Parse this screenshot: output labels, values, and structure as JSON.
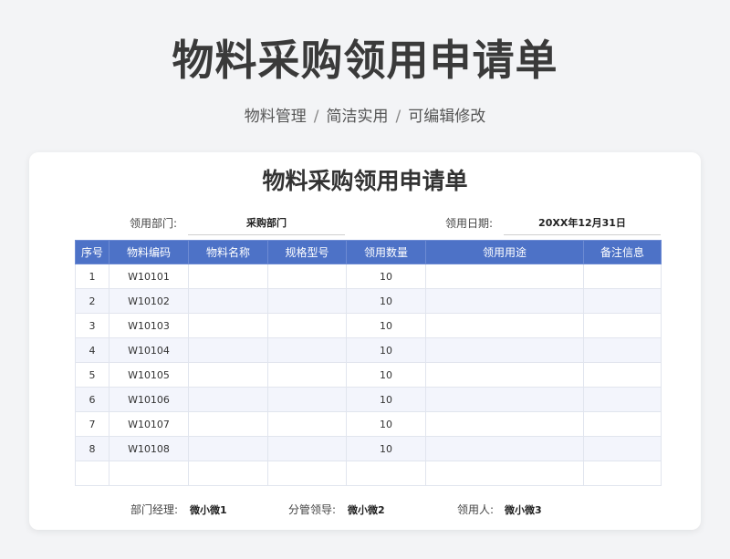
{
  "hero": {
    "title": "物料采购领用申请单",
    "subtitle_parts": [
      "物料管理",
      "简洁实用",
      "可编辑修改"
    ],
    "separator": "/"
  },
  "form": {
    "title": "物料采购领用申请单",
    "department_label": "领用部门:",
    "department_value": "采购部门",
    "date_label": "领用日期:",
    "date_value": "20XX年12月31日"
  },
  "table": {
    "headers": [
      "序号",
      "物料编码",
      "物料名称",
      "规格型号",
      "领用数量",
      "领用用途",
      "备注信息"
    ],
    "rows": [
      [
        "1",
        "W10101",
        "",
        "",
        "10",
        "",
        ""
      ],
      [
        "2",
        "W10102",
        "",
        "",
        "10",
        "",
        ""
      ],
      [
        "3",
        "W10103",
        "",
        "",
        "10",
        "",
        ""
      ],
      [
        "4",
        "W10104",
        "",
        "",
        "10",
        "",
        ""
      ],
      [
        "5",
        "W10105",
        "",
        "",
        "10",
        "",
        ""
      ],
      [
        "6",
        "W10106",
        "",
        "",
        "10",
        "",
        ""
      ],
      [
        "7",
        "W10107",
        "",
        "",
        "10",
        "",
        ""
      ],
      [
        "8",
        "W10108",
        "",
        "",
        "10",
        "",
        ""
      ],
      [
        "",
        "",
        "",
        "",
        "",
        "",
        ""
      ]
    ]
  },
  "signatures": {
    "manager_label": "部门经理:",
    "manager_value": "微小微1",
    "supervisor_label": "分管领导:",
    "supervisor_value": "微小微2",
    "receiver_label": "领用人:",
    "receiver_value": "微小微3"
  }
}
